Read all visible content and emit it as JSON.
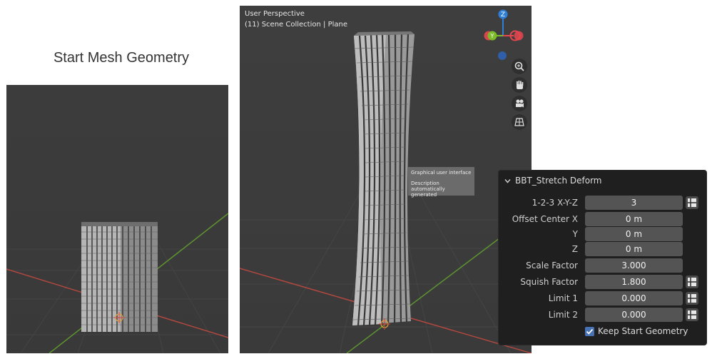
{
  "left_title": "Start Mesh Geometry",
  "viewport": {
    "line1": "User Perspective",
    "line2": "(11) Scene Collection | Plane"
  },
  "gizmo": {
    "z": "Z",
    "y": "Y"
  },
  "nav_icons": [
    "zoom-icon",
    "hand-pan-icon",
    "camera-icon",
    "grid-view-icon"
  ],
  "tooltip": {
    "line1": "Graphical user interface",
    "line2": "Description automatically generated"
  },
  "panel": {
    "title": "BBT_Stretch Deform",
    "rows": [
      {
        "label": "1-2-3 X-Y-Z",
        "value": "3",
        "flag": true
      },
      {
        "label": "Offset Center X",
        "value": "0 m",
        "flag": false
      },
      {
        "label": "Y",
        "value": "0 m",
        "flag": false
      },
      {
        "label": "Z",
        "value": "0 m",
        "flag": false
      },
      {
        "label": "Scale Factor",
        "value": "3.000",
        "flag": false
      },
      {
        "label": "Squish Factor",
        "value": "1.800",
        "flag": true
      },
      {
        "label": "Limit 1",
        "value": "0.000",
        "flag": true
      },
      {
        "label": "Limit 2",
        "value": "0.000",
        "flag": true
      }
    ],
    "checkbox_label": "Keep Start Geometry",
    "checkbox_checked": true
  },
  "colors": {
    "gizmo_z": "#2f7fd6",
    "gizmo_y": "#7dbb2b",
    "gizmo_x": "#e8474f",
    "checkbox_blue": "#4772b3",
    "axis_red": "#c0463f",
    "axis_green": "#6a9e32"
  }
}
